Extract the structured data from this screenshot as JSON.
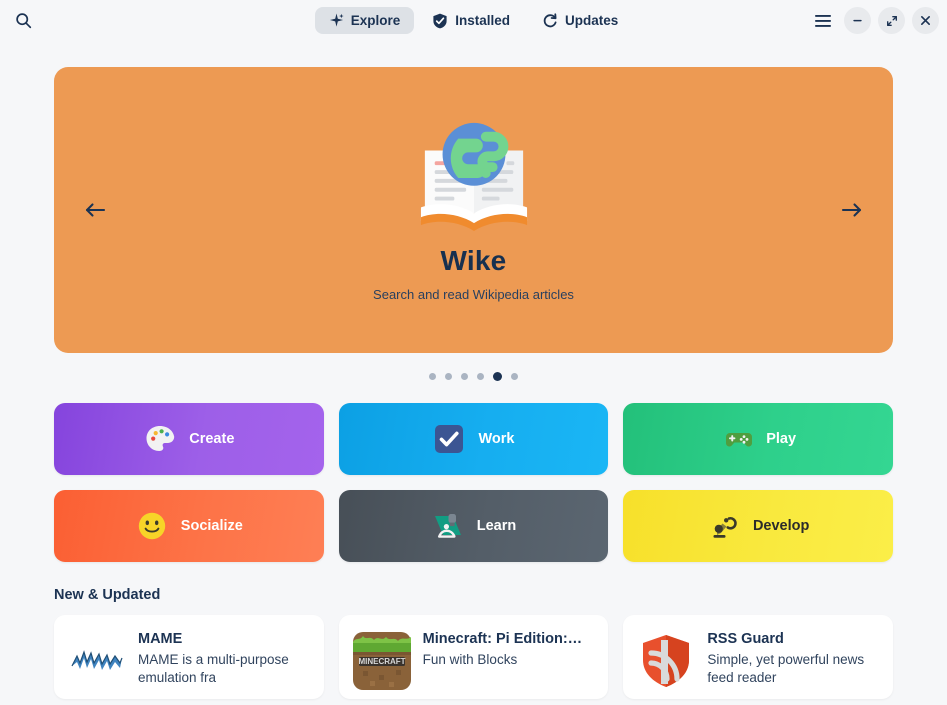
{
  "header": {
    "search_icon": "search-icon",
    "tabs": [
      {
        "label": "Explore",
        "icon": "sparkle-icon",
        "active": true
      },
      {
        "label": "Installed",
        "icon": "check-badge-icon",
        "active": false
      },
      {
        "label": "Updates",
        "icon": "refresh-icon",
        "active": false
      }
    ],
    "window_controls": [
      {
        "name": "menu-button",
        "icon": "hamburger-icon"
      },
      {
        "name": "minimize-button",
        "icon": "minus-icon"
      },
      {
        "name": "maximize-button",
        "icon": "expand-icon"
      },
      {
        "name": "close-button",
        "icon": "close-icon"
      }
    ]
  },
  "banner": {
    "title": "Wike",
    "subtitle": "Search and read Wikipedia articles",
    "background_color": "#ed9a53",
    "title_color": "#17304f",
    "app_icon": "wike-book-globe-icon",
    "prev_label": "←",
    "next_label": "→",
    "dots_total": 6,
    "dot_active_index": 4
  },
  "categories": [
    {
      "label": "Create",
      "icon": "palette-icon",
      "color": "#9d5fe8",
      "text_dark": false
    },
    {
      "label": "Work",
      "icon": "checkbox-icon",
      "color": "#16aef0",
      "text_dark": false
    },
    {
      "label": "Play",
      "icon": "gamepad-icon",
      "color": "#2ed08b",
      "text_dark": false
    },
    {
      "label": "Socialize",
      "icon": "smiley-icon",
      "color": "#fd7347",
      "text_dark": false
    },
    {
      "label": "Learn",
      "icon": "microscope-icon",
      "color": "#545e68",
      "text_dark": false
    },
    {
      "label": "Develop",
      "icon": "robot-arm-icon",
      "color": "#f9e93e",
      "text_dark": true
    }
  ],
  "new_updated": {
    "title": "New & Updated",
    "apps": [
      {
        "name": "MAME",
        "desc": "MAME is a multi-purpose emulation fra",
        "icon": "mame-logo-icon"
      },
      {
        "name": "Minecraft: Pi Edition:…",
        "desc": "Fun with Blocks",
        "icon": "minecraft-icon"
      },
      {
        "name": "RSS Guard",
        "desc": "Simple, yet powerful news feed reader",
        "icon": "rss-guard-shield-icon"
      }
    ]
  }
}
